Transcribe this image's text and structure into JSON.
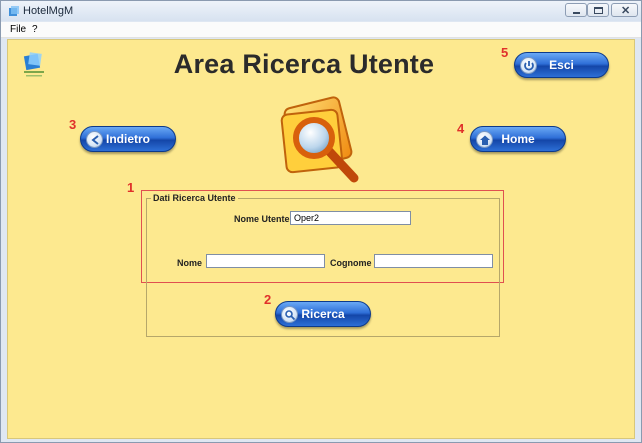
{
  "window": {
    "title": "HotelMgM"
  },
  "menu": {
    "items": [
      "File",
      "?"
    ]
  },
  "page": {
    "title": "Area Ricerca Utente"
  },
  "buttons": {
    "exit": "Esci",
    "back": "Indietro",
    "home": "Home",
    "search": "Ricerca"
  },
  "markers": {
    "fieldset": "1",
    "search": "2",
    "back": "3",
    "home": "4",
    "exit": "5"
  },
  "form": {
    "legend": "Dati Ricerca Utente",
    "username_label": "Nome Utente",
    "username_value": "Oper2",
    "name_label": "Nome",
    "name_value": "",
    "surname_label": "Cognome",
    "surname_value": ""
  },
  "colors": {
    "background": "#fde98f",
    "button_blue": "#2f6fd7",
    "marker_red": "#e0302a"
  },
  "icons": {
    "app": "hotel-app-icon",
    "logo": "hotel-logo-icon",
    "exit": "exit-arrow-icon",
    "back": "back-arrow-icon",
    "home": "house-icon",
    "search": "magnifier-icon",
    "banner": "folder-magnifier-icon"
  }
}
